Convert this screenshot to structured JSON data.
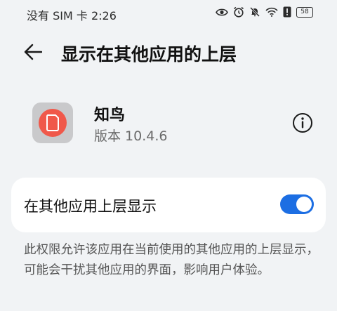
{
  "status": {
    "text": "没有 SIM 卡 2:26",
    "battery": "58"
  },
  "header": {
    "title": "显示在其他应用的上层"
  },
  "app": {
    "name": "知鸟",
    "version": "版本 10.4.6"
  },
  "setting": {
    "label": "在其他应用上层显示",
    "enabled": true
  },
  "description": "此权限允许该应用在当前使用的其他应用的上层显示，可能会干扰其他应用的界面，影响用户体验。",
  "colors": {
    "accent": "#1c6ee3",
    "app_icon": "#f0584a"
  }
}
